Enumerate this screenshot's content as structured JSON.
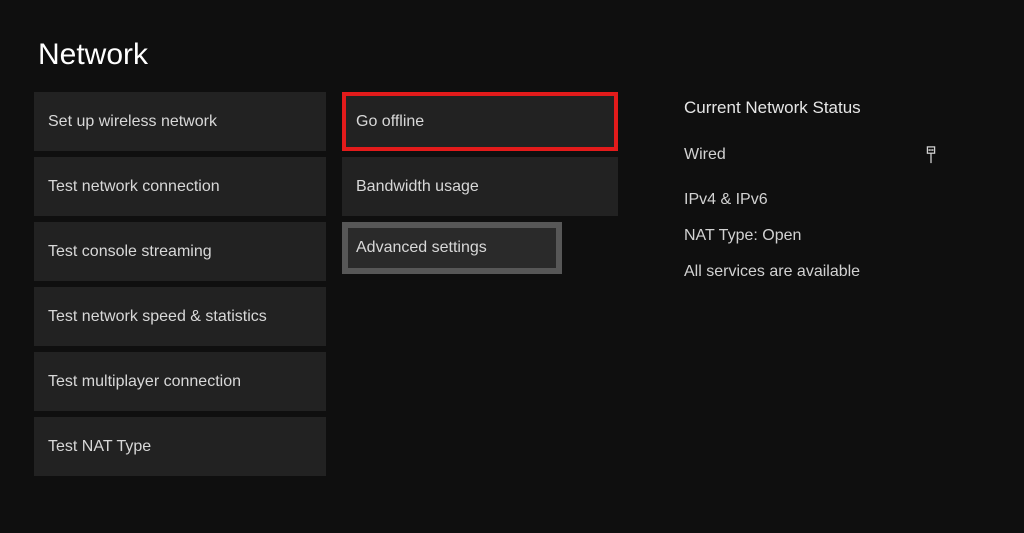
{
  "title": "Network",
  "left": {
    "items": [
      "Set up wireless network",
      "Test network connection",
      "Test console streaming",
      "Test network speed & statistics",
      "Test multiplayer connection",
      "Test NAT Type"
    ]
  },
  "middle": {
    "items": [
      "Go offline",
      "Bandwidth usage",
      "Advanced settings"
    ]
  },
  "status": {
    "title": "Current Network Status",
    "connection": "Wired",
    "ip": "IPv4 & IPv6",
    "nat": "NAT Type: Open",
    "services": "All services are available",
    "icon_name": "wired-connection-icon"
  }
}
